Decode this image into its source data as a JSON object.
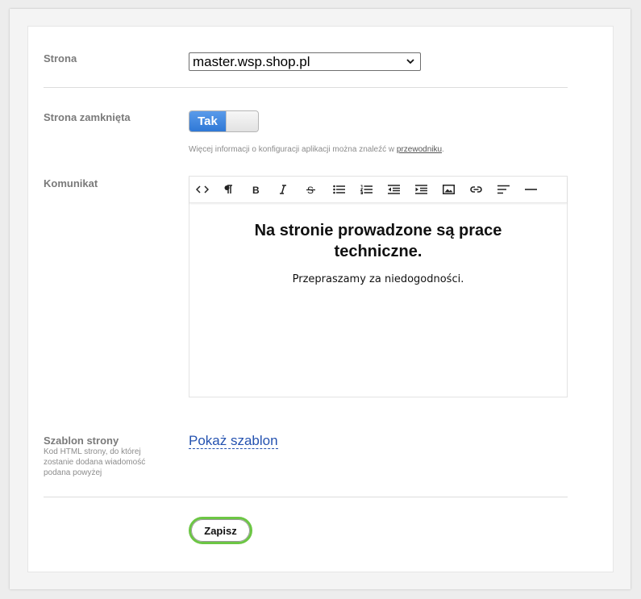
{
  "form": {
    "site_label": "Strona",
    "site_value": "master.wsp.shop.pl",
    "closed_label": "Strona zamknięta",
    "toggle_on_label": "Tak",
    "help_prefix": "Więcej informacji o konfiguracji aplikacji można znaleźć w ",
    "help_link": "przewodniku",
    "help_suffix": ".",
    "message_label": "Komunikat",
    "template_label": "Szablon strony",
    "template_sublabel": "Kod HTML strony, do której zostanie dodana wiadomość podana powyżej",
    "template_link": "Pokaż szablon",
    "save_label": "Zapisz"
  },
  "editor": {
    "toolbar": [
      "code-view-icon",
      "paragraph-icon",
      "bold-icon",
      "italic-icon",
      "strikethrough-icon",
      "unordered-list-icon",
      "ordered-list-icon",
      "outdent-icon",
      "indent-icon",
      "image-icon",
      "link-icon",
      "align-icon",
      "horizontal-rule-icon"
    ],
    "heading": "Na stronie prowadzone są prace techniczne.",
    "paragraph": "Przepraszamy za niedogodności."
  },
  "colors": {
    "toggle_on": "#3f86e0",
    "save_border": "#6cc644",
    "link": "#2452b0"
  }
}
